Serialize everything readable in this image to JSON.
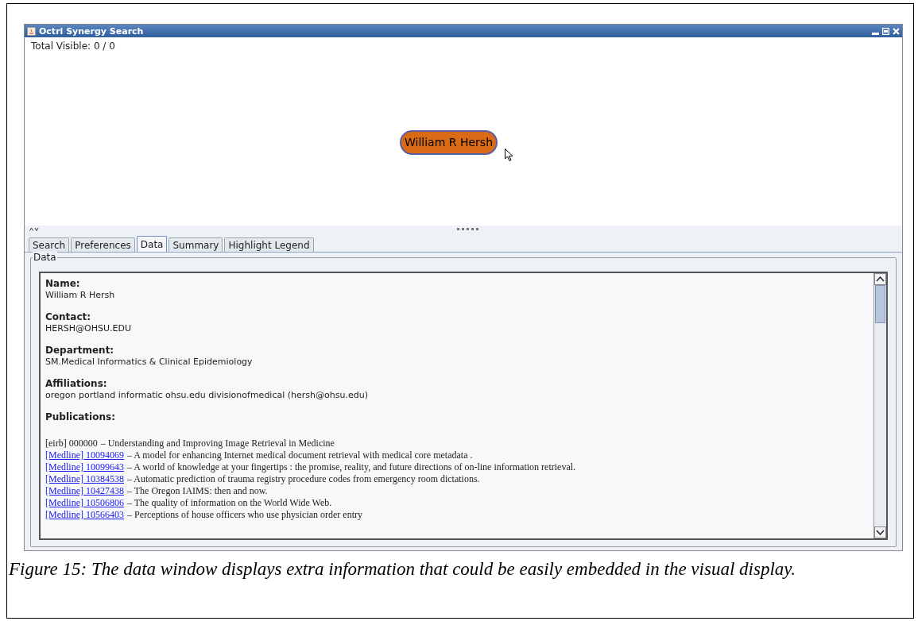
{
  "window": {
    "title": "Octri Synergy Search"
  },
  "total_visible": "Total Visible: 0 / 0",
  "node": {
    "label": "William R Hersh"
  },
  "tabs": [
    {
      "label": "Search",
      "selected": false
    },
    {
      "label": "Preferences",
      "selected": false
    },
    {
      "label": "Data",
      "selected": true
    },
    {
      "label": "Summary",
      "selected": false
    },
    {
      "label": "Highlight Legend",
      "selected": false
    }
  ],
  "data_panel": {
    "title": "Data",
    "fields": [
      {
        "label": "Name:",
        "value": "William R Hersh"
      },
      {
        "label": "Contact:",
        "value": "HERSH@OHSU.EDU"
      },
      {
        "label": "Department:",
        "value": "SM.Medical Informatics & Clinical Epidemiology"
      },
      {
        "label": "Affiliations:",
        "value": "oregon portland informatic ohsu.edu divisionofmedical (hersh@ohsu.edu)"
      }
    ],
    "publications_label": "Publications:",
    "publications": [
      {
        "ref": "[eirb] 000000",
        "linked": false,
        "title": "– Understanding and Improving Image Retrieval in Medicine"
      },
      {
        "ref": "[Medline] 10094069",
        "linked": true,
        "title": "– A model for enhancing Internet medical document retrieval with medical core metadata ."
      },
      {
        "ref": "[Medline] 10099643",
        "linked": true,
        "title": "– A world of knowledge at your fingertips : the promise, reality, and future directions of on-line information retrieval."
      },
      {
        "ref": "[Medline] 10384538",
        "linked": true,
        "title": "– Automatic prediction of trauma registry procedure codes from emergency room dictations."
      },
      {
        "ref": "[Medline] 10427438",
        "linked": true,
        "title": "– The Oregon IAIMS: then and now."
      },
      {
        "ref": "[Medline] 10506806",
        "linked": true,
        "title": "– The quality of information on the World Wide Web."
      },
      {
        "ref": "[Medline] 10566403",
        "linked": true,
        "title": "– Perceptions of house officers who use physician order entry"
      }
    ]
  },
  "caption": "Figure 15: The data window displays extra information that could be easily embedded in the visual display."
}
